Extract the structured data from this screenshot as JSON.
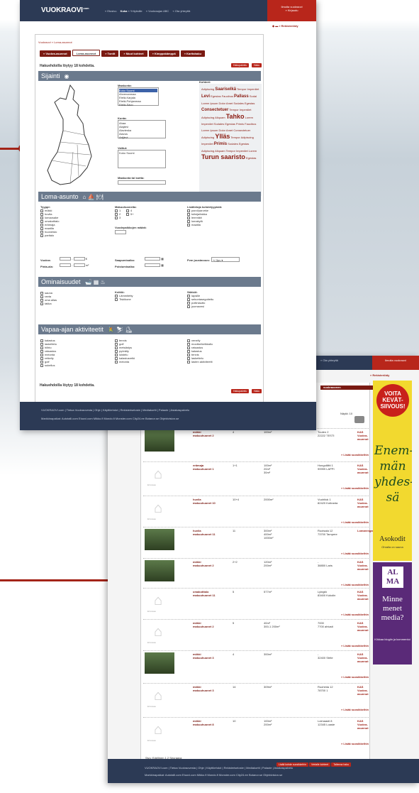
{
  "colors": {
    "accent": "#b8261b",
    "header": "#2c3a55",
    "section": "#6b7a8d"
  },
  "front": {
    "logo": "VUOKRAOVI",
    "logo_suffix": ".com",
    "nav": [
      "« Etusivu",
      "Kohde",
      "« Yrityksille",
      "« Vuokraajan ABC",
      "« Ota yhteyttä"
    ],
    "nav_active": "Kuka",
    "promo": [
      "Ilmoita vuokraovi",
      "» Kirjaudu"
    ],
    "lang": "» Rekisteröidy",
    "breadcrumb": "Vuokraovi » Loma-asunnot",
    "tabs": [
      "» Vuokra-asunnot",
      "Loma-asunnot",
      "» Tontit",
      "» Muut kohteet",
      "» Kimppakämppä",
      "» Karttahaku"
    ],
    "found": "Hakuehdoilla löytyy 18 kohdetta.",
    "search_btn": "Hakupalvelu",
    "clear_btn": "Haku",
    "sec_location": "Sijainti",
    "map_icon": "globe-icon",
    "label_province": "Maakunta:",
    "provinces": [
      "Koko Suomi",
      "Ahvenanmaa",
      "Etelä-Karjala",
      "Etelä-Pohjanmaa",
      "Etelä-Savo"
    ],
    "label_municipality": "Kunta:",
    "municipalities": [
      "Ahaa",
      "Alajärvi",
      "Alavieska",
      "Alavus",
      "Artjärvi"
    ],
    "label_selected": "Valitut:",
    "selected": "Koko Suomi",
    "label_map": "Maakunta tai kartta:",
    "label_places": "Kohteet:",
    "cloud": [
      {
        "t": "Adipiscing ",
        "s": "n"
      },
      {
        "t": "Saariselkä",
        "s": "m"
      },
      {
        "t": " Tempor Imperdiet ",
        "s": "n"
      },
      {
        "t": "Levi",
        "s": "m"
      },
      {
        "t": " Egestas Faucibus ",
        "s": "n"
      },
      {
        "t": "Pallass",
        "s": "m"
      },
      {
        "t": " Sodal Lorem Ipsum Dolor Amet Sodales Egestas ",
        "s": "n"
      },
      {
        "t": "Consectetuer",
        "s": "m"
      },
      {
        "t": " Tempor Imperdiet Adipiscing Aliquam ",
        "s": "n"
      },
      {
        "t": "Tahko",
        "s": "b"
      },
      {
        "t": " Lorem Imperdiet Sodales Egestas Primis Faucibus Lorem Ipsum Dolor Amet Consectetuer Adipiscing ",
        "s": "n"
      },
      {
        "t": "Ylläs",
        "s": "b"
      },
      {
        "t": " Tempor Adipiscing Imperdiet ",
        "s": "n"
      },
      {
        "t": "Primis",
        "s": "m"
      },
      {
        "t": " Sodales Egestas Adipiscing Aliquam Tempor Imperdiet Lorem ",
        "s": "n"
      },
      {
        "t": "Turun saaristo",
        "s": "b"
      },
      {
        "t": " Egestas",
        "s": "n"
      }
    ],
    "sec_holiday": "Loma-asunto",
    "holiday_icons": "⌂ ⛵ 🍽",
    "label_types": "Tyyppi:",
    "types": [
      "mökki",
      "huvila",
      "lomaosake",
      "omakotitalo",
      "erämaja",
      "maatila",
      "huoneisto",
      "paritalo"
    ],
    "label_rooms": "Makuuhuoneita:",
    "rooms": [
      "1",
      "4",
      "2",
      "5+",
      "3"
    ],
    "label_beds": "Vuodepaikkojen määrä:",
    "label_extra": "Lisätietoja kohdetyypistä:",
    "extra": [
      "parvi/parveke",
      "tulisija/takka",
      "lemmikit",
      "lomakylä",
      "maatila"
    ],
    "label_rent": "Vuokra:",
    "label_size": "Pinta-ala:",
    "unit_rent": "€",
    "unit_size": "m²",
    "label_arrival": "Saapumisaika:",
    "label_departure": "Poistumisaika:",
    "label_flex": "Pvm joustavuus:",
    "flex_value": "+/-3pv",
    "sec_props": "Ominaisuudet",
    "props_icons": "🛁 ▦ ♨",
    "props1": [
      "sauna",
      "ranta",
      "oma allas",
      "takka"
    ],
    "label_kitchen": "Keittiö:",
    "kitchen": [
      "Lämmitetty",
      "Tiskikone"
    ],
    "label_elec": "Sähköt:",
    "elec": [
      "lapsille",
      "sekuntasegoitettu",
      "poltinlautto",
      "juomavesi"
    ],
    "sec_acts": "Vapaa-ajan aktiviteetit",
    "acts_icons": "🚴 ⛷ ⛸",
    "acts": [
      "kalastus",
      "laskettelu",
      "hiihto",
      "ratsastus",
      "melonta",
      "retkeily",
      "golf",
      "sukellus",
      "tennis",
      "golf",
      "metsästys",
      "pyöräily",
      "luistelu",
      "kalastusretki",
      "melonta",
      "veneily",
      "moottorikelkkailu",
      "ratsastus",
      "kalastus",
      "tennis",
      "laskettelu",
      "lasten aktiviteetit"
    ],
    "found2": "Hakuehdoilla löytyy 18 kohdetta.",
    "foot_links": "VUOKRAOVI.com  |  Tietoa Vuokraovesta  |  Ohje  |  Käyttöehdot  |  Rekisteriseloste  |  Mediakortti  |  Palaute  |  Asiakaspalvelu",
    "foot_partners": "Markkinapaikat: Autotalli.com  Etuovi.com  Mikko.fi  Mondo.fi  Monster.com  City24.ee  Botanor.se  Objektvision.se"
  },
  "back": {
    "nav": "» Ota yhteyttä",
    "promo": "Ilmoita vuokraovi",
    "lang": "» Rekisteröidy",
    "tab": "vuokraoveen",
    "filter": "Näytä: 10",
    "listings": [
      {
        "title": "mökki\nmakuuhuonet 2",
        "rooms": "4",
        "size": "100m²",
        "addr": "Tuulen 2\n22222 TESTI",
        "company": "KAS Vuokra-asunnot",
        "photo": true
      },
      {
        "title": "erämaja\nmakuuhuonet 1",
        "rooms": "1+1",
        "size": "100m²\n20m²\n30m²",
        "addr": "Hongoiliitti 1\n99999 LAPPI",
        "company": "KAS Vuokra-asunnot",
        "photo": false
      },
      {
        "title": "huvila\nmakuuhuonet 10",
        "rooms": "10+4",
        "size": "2000m²",
        "addr": "Vuohitok 1\n82420 Kotiranta",
        "company": "KAS Vuokra-asunnot",
        "photo": false
      },
      {
        "title": "huvila\nmakuuhuonet 11",
        "rooms": "11",
        "size": "300m²\n400m²\n1000m²",
        "addr": "Ruotsala 12\n73700 Tampere",
        "company": "Lomarengas.fi",
        "photo": true
      },
      {
        "title": "mökki\nmakuuhuonet 2",
        "rooms": "2+2",
        "size": "120m²\n200m²",
        "addr": "-\n38850 Laris",
        "company": "KAS Vuokra-asunnot",
        "photo": true
      },
      {
        "title": "omakotitalo\nmakuuhuonet 11",
        "rooms": "5",
        "size": "577m²",
        "addr": "Lyingtä\n83400 Kokolin",
        "company": "KAS Vuokra-asunnot",
        "photo": false
      },
      {
        "title": "mökki\nmakuuhuonet 2",
        "rooms": "5",
        "size": "40m²\n300-1 200m²",
        "addr": "7000\n7700 ahtusti",
        "company": "KAS Vuokra-asunnot",
        "photo": false
      },
      {
        "title": "mökki\nmakuuhuonet 3",
        "rooms": "4",
        "size": "300m²",
        "addr": "-\n32400 Strite",
        "company": "KAS Vuokra-asunnot",
        "photo": true
      },
      {
        "title": "mökki\nmakuuhuonet 3",
        "rooms": "14",
        "size": "309m²",
        "addr": "Ruohinta 12\n78700 1",
        "company": "KAS Vuokra-asunnot",
        "photo": false
      },
      {
        "title": "mökki\nmakuuhuonet 8",
        "rooms": "10",
        "size": "100m²\n200m²",
        "addr": "Loimaasti 8\n12345 Loaste",
        "company": "KAS Vuokra-asunnot",
        "photo": false
      }
    ],
    "more": "» Lisää suosikkeihin",
    "no_pic": "Ei kuvaa",
    "pager": "Sivu: Edellinen 1 2 Seuraava",
    "btns": [
      "Lisää kohde suosikkeihin",
      "Vertaile kohteet",
      "Tallenna haku"
    ],
    "foot_links": "VUOKRAOVI.com  |  Tietoa Vuokraovesta  |  Ohje  |  Käyttöehdot  |  Rekisteriseloste  |  Mediakortti  |  Palaute  |  Asiakaspalvelu",
    "foot_partners": "Markkinapaikat: Autotalli.com  Etuovi.com  Mikko.fi  Mondo.fi  Monster.com  City24.ee  Botanor.se  Objektvision.se"
  },
  "ads": {
    "voita": "VOITA KEVÄT-SIIVOUS!",
    "enemman": "Enem-män yhdes-sä",
    "asokodit": "Asokodit",
    "asokodit_sub": "Ohralla on sauna",
    "alma": "AL MA",
    "minne": "Minne menet media?",
    "klikkaa": "Klikkaa blogiin ja kommentoi"
  }
}
